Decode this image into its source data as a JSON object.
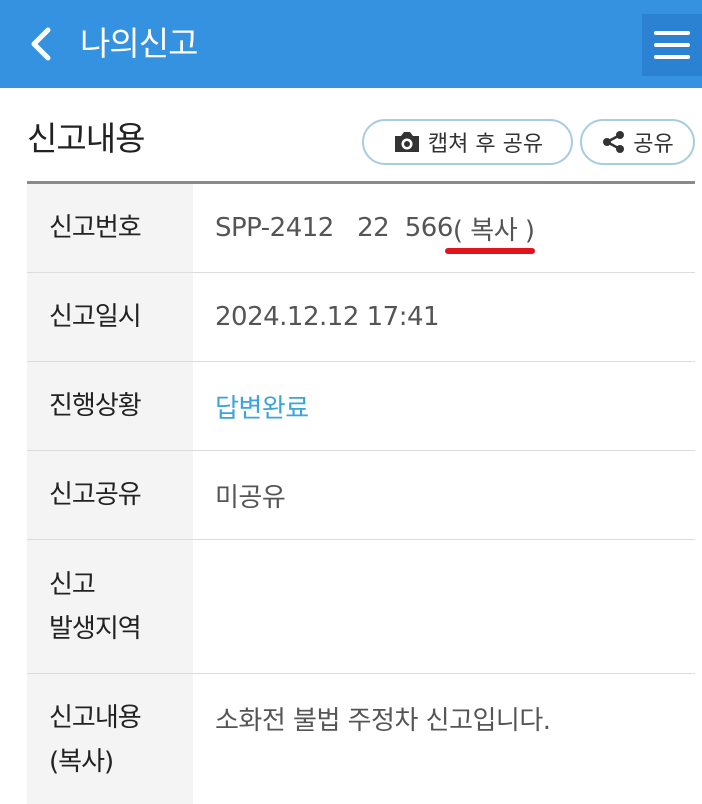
{
  "header": {
    "title": "나의신고",
    "colors": {
      "appbar": "#3592e0",
      "menu_button": "#2b82d2"
    }
  },
  "section": {
    "title": "신고내용",
    "capture_share_label": "캡쳐 후 공유",
    "share_label": "공유"
  },
  "details": {
    "report_number": {
      "label": "신고번호",
      "value": "SPP-2412   22  566",
      "copy_label": "( 복사 )"
    },
    "report_datetime": {
      "label": "신고일시",
      "value": "2024.12.12 17:41"
    },
    "progress_status": {
      "label": "진행상황",
      "value": "답변완료",
      "color": "#3aa4dc"
    },
    "report_sharing": {
      "label": "신고공유",
      "value": "미공유"
    },
    "location": {
      "label_line1": "신고",
      "label_line2": "발생지역",
      "value": ""
    },
    "content": {
      "label_line1": "신고내용",
      "label_line2": "(복사)",
      "value": "소화전 불법 주정차 신고입니다."
    }
  },
  "icons": [
    "back-chevron-icon",
    "hamburger-menu-icon",
    "camera-icon",
    "share-icon"
  ]
}
